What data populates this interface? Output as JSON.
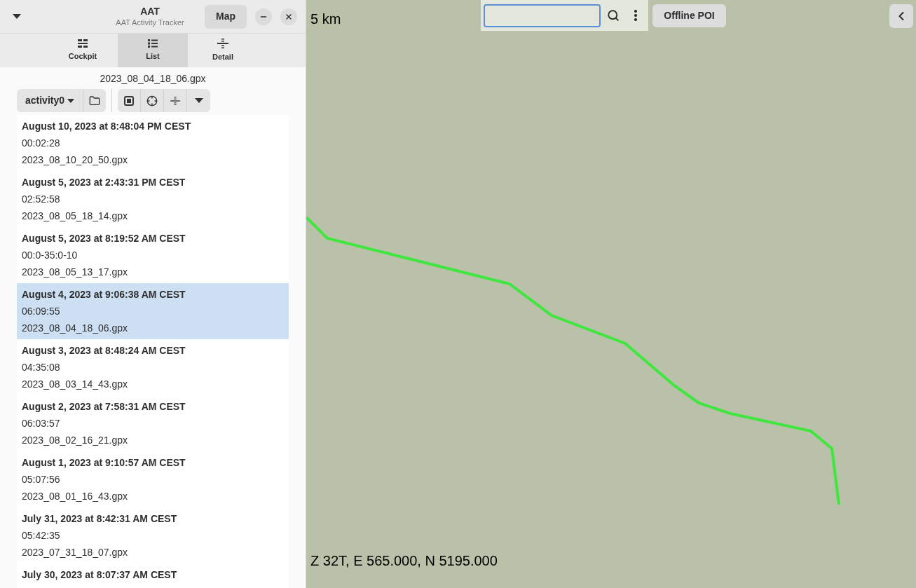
{
  "header": {
    "title": "AAT",
    "subtitle": "AAT Activity Tracker",
    "map_button": "Map"
  },
  "tabs": [
    {
      "label": "Cockpit",
      "kind": "cockpit",
      "selected": false
    },
    {
      "label": "List",
      "kind": "list",
      "selected": true
    },
    {
      "label": "Detail",
      "kind": "detail",
      "selected": false
    }
  ],
  "current_file": "2023_08_04_18_06.gpx",
  "toolbar": {
    "activity": "activity0"
  },
  "activities": [
    {
      "date": "August 10, 2023 at 8:48:04 PM CEST",
      "duration": "00:02:28",
      "file": "2023_08_10_20_50.gpx",
      "selected": false
    },
    {
      "date": "August 5, 2023 at 2:43:31 PM CEST",
      "duration": "02:52:58",
      "file": "2023_08_05_18_14.gpx",
      "selected": false
    },
    {
      "date": "August 5, 2023 at 8:19:52 AM CEST",
      "duration": "00:0-35:0-10",
      "file": "2023_08_05_13_17.gpx",
      "selected": false
    },
    {
      "date": "August 4, 2023 at 9:06:38 AM CEST",
      "duration": "06:09:55",
      "file": "2023_08_04_18_06.gpx",
      "selected": true
    },
    {
      "date": "August 3, 2023 at 8:48:24 AM CEST",
      "duration": "04:35:08",
      "file": "2023_08_03_14_43.gpx",
      "selected": false
    },
    {
      "date": "August 2, 2023 at 7:58:31 AM CEST",
      "duration": "06:03:57",
      "file": "2023_08_02_16_21.gpx",
      "selected": false
    },
    {
      "date": "August 1, 2023 at 9:10:57 AM CEST",
      "duration": "05:07:56",
      "file": "2023_08_01_16_43.gpx",
      "selected": false
    },
    {
      "date": "July 31, 2023 at 8:42:31 AM CEST",
      "duration": "05:42:35",
      "file": "2023_07_31_18_07.gpx",
      "selected": false
    },
    {
      "date": "July 30, 2023 at 8:07:37 AM CEST",
      "selected": false
    }
  ],
  "map": {
    "scale": "5 km",
    "offline_poi": "Offline POI",
    "coordinates": "Z 32T, E 565.000, N 5195.000"
  }
}
